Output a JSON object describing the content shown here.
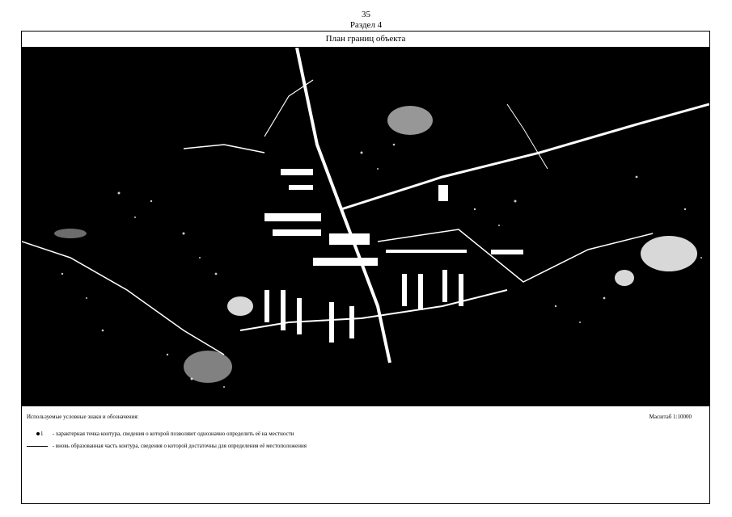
{
  "header": {
    "page_number": "35",
    "section": "Раздел 4"
  },
  "map": {
    "title": "План границ объекта"
  },
  "legend": {
    "title": "Используемые условные знаки и обозначения:",
    "scale": "Масштаб 1:10000",
    "items": [
      {
        "symbol": "point-icon",
        "symbol_label": "1",
        "text": "- характерная точка контура, сведения о которой позволяют однозначно определить её на местности"
      },
      {
        "symbol": "line-icon",
        "text": "- вновь образованная часть контура, сведения о которой достаточны для определения её местоположения"
      }
    ]
  },
  "colors": {
    "background": "#000000",
    "features": "#ffffff"
  }
}
